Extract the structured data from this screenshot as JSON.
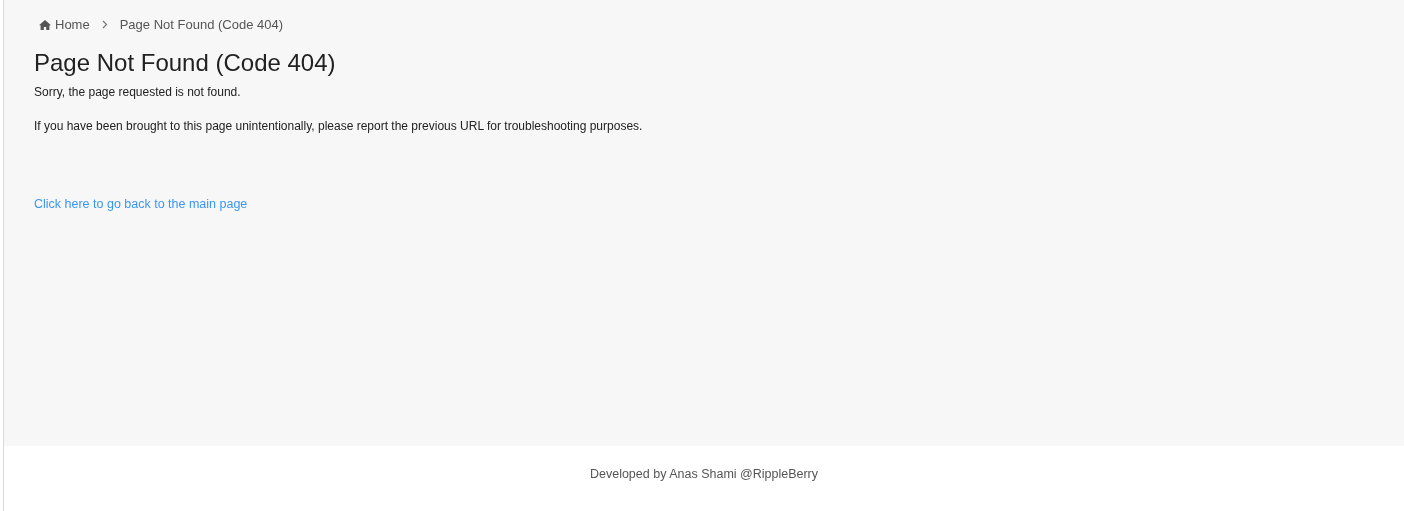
{
  "breadcrumb": [
    {
      "label": "Home",
      "kind": "home"
    },
    {
      "label": "Page Not Found (Code 404)",
      "kind": "current"
    }
  ],
  "heading": "Page Not Found (Code 404)",
  "paragraphs": [
    "Sorry, the page requested is not found.",
    "If you have been brought to this page unintentionally, please report the previous URL for troubleshooting purposes."
  ],
  "link": "Click here to go back to the main page",
  "footer": "Developed by Anas Shami @RippleBerry"
}
